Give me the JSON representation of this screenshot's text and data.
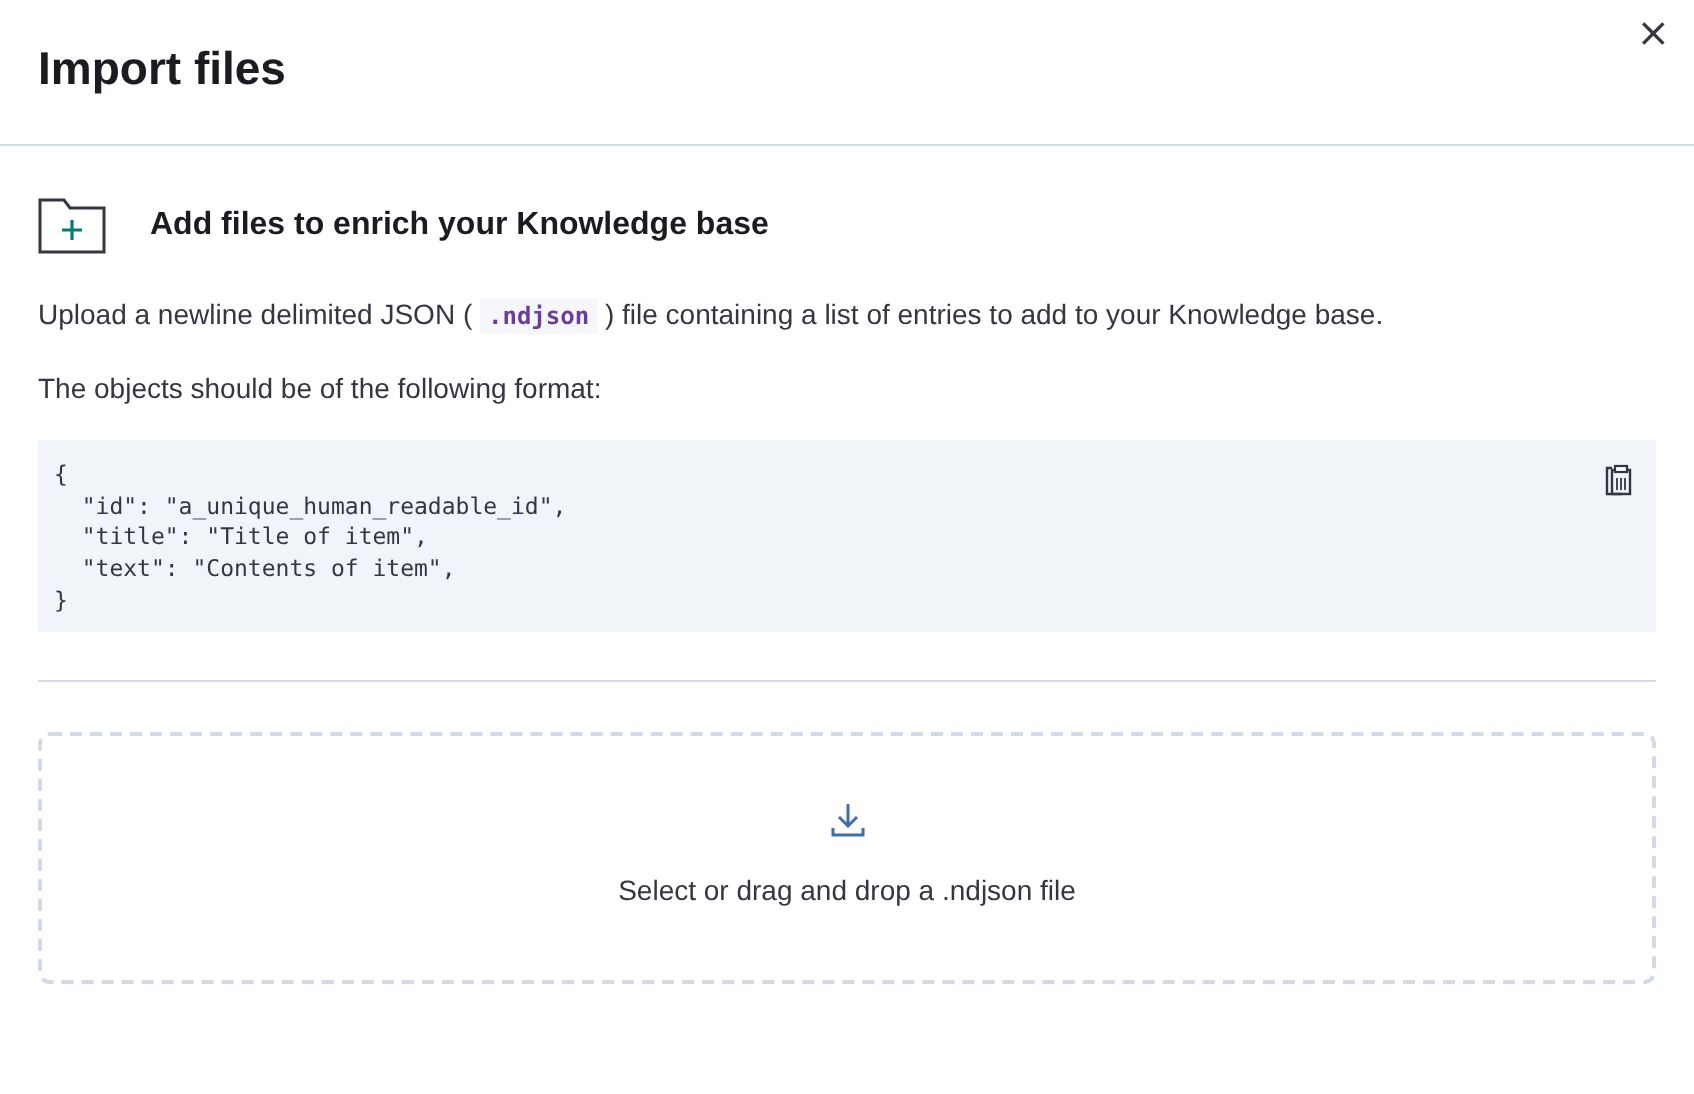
{
  "modal": {
    "title": "Import files",
    "close_label": "×"
  },
  "section": {
    "heading": "Add files to enrich your Knowledge base"
  },
  "description": {
    "before": "Upload a newline delimited JSON (",
    "code": ".ndjson",
    "after": ") file containing a list of entries to add to your Knowledge base."
  },
  "format_note": "The objects should be of the following format:",
  "code_block": {
    "lines": [
      "{",
      "  \"id\": \"a_unique_human_readable_id\",",
      "  \"title\": \"Title of item\",",
      "  \"text\": \"Contents of item\",",
      "}"
    ]
  },
  "dropzone": {
    "prompt": "Select or drag and drop a .ndjson file"
  }
}
